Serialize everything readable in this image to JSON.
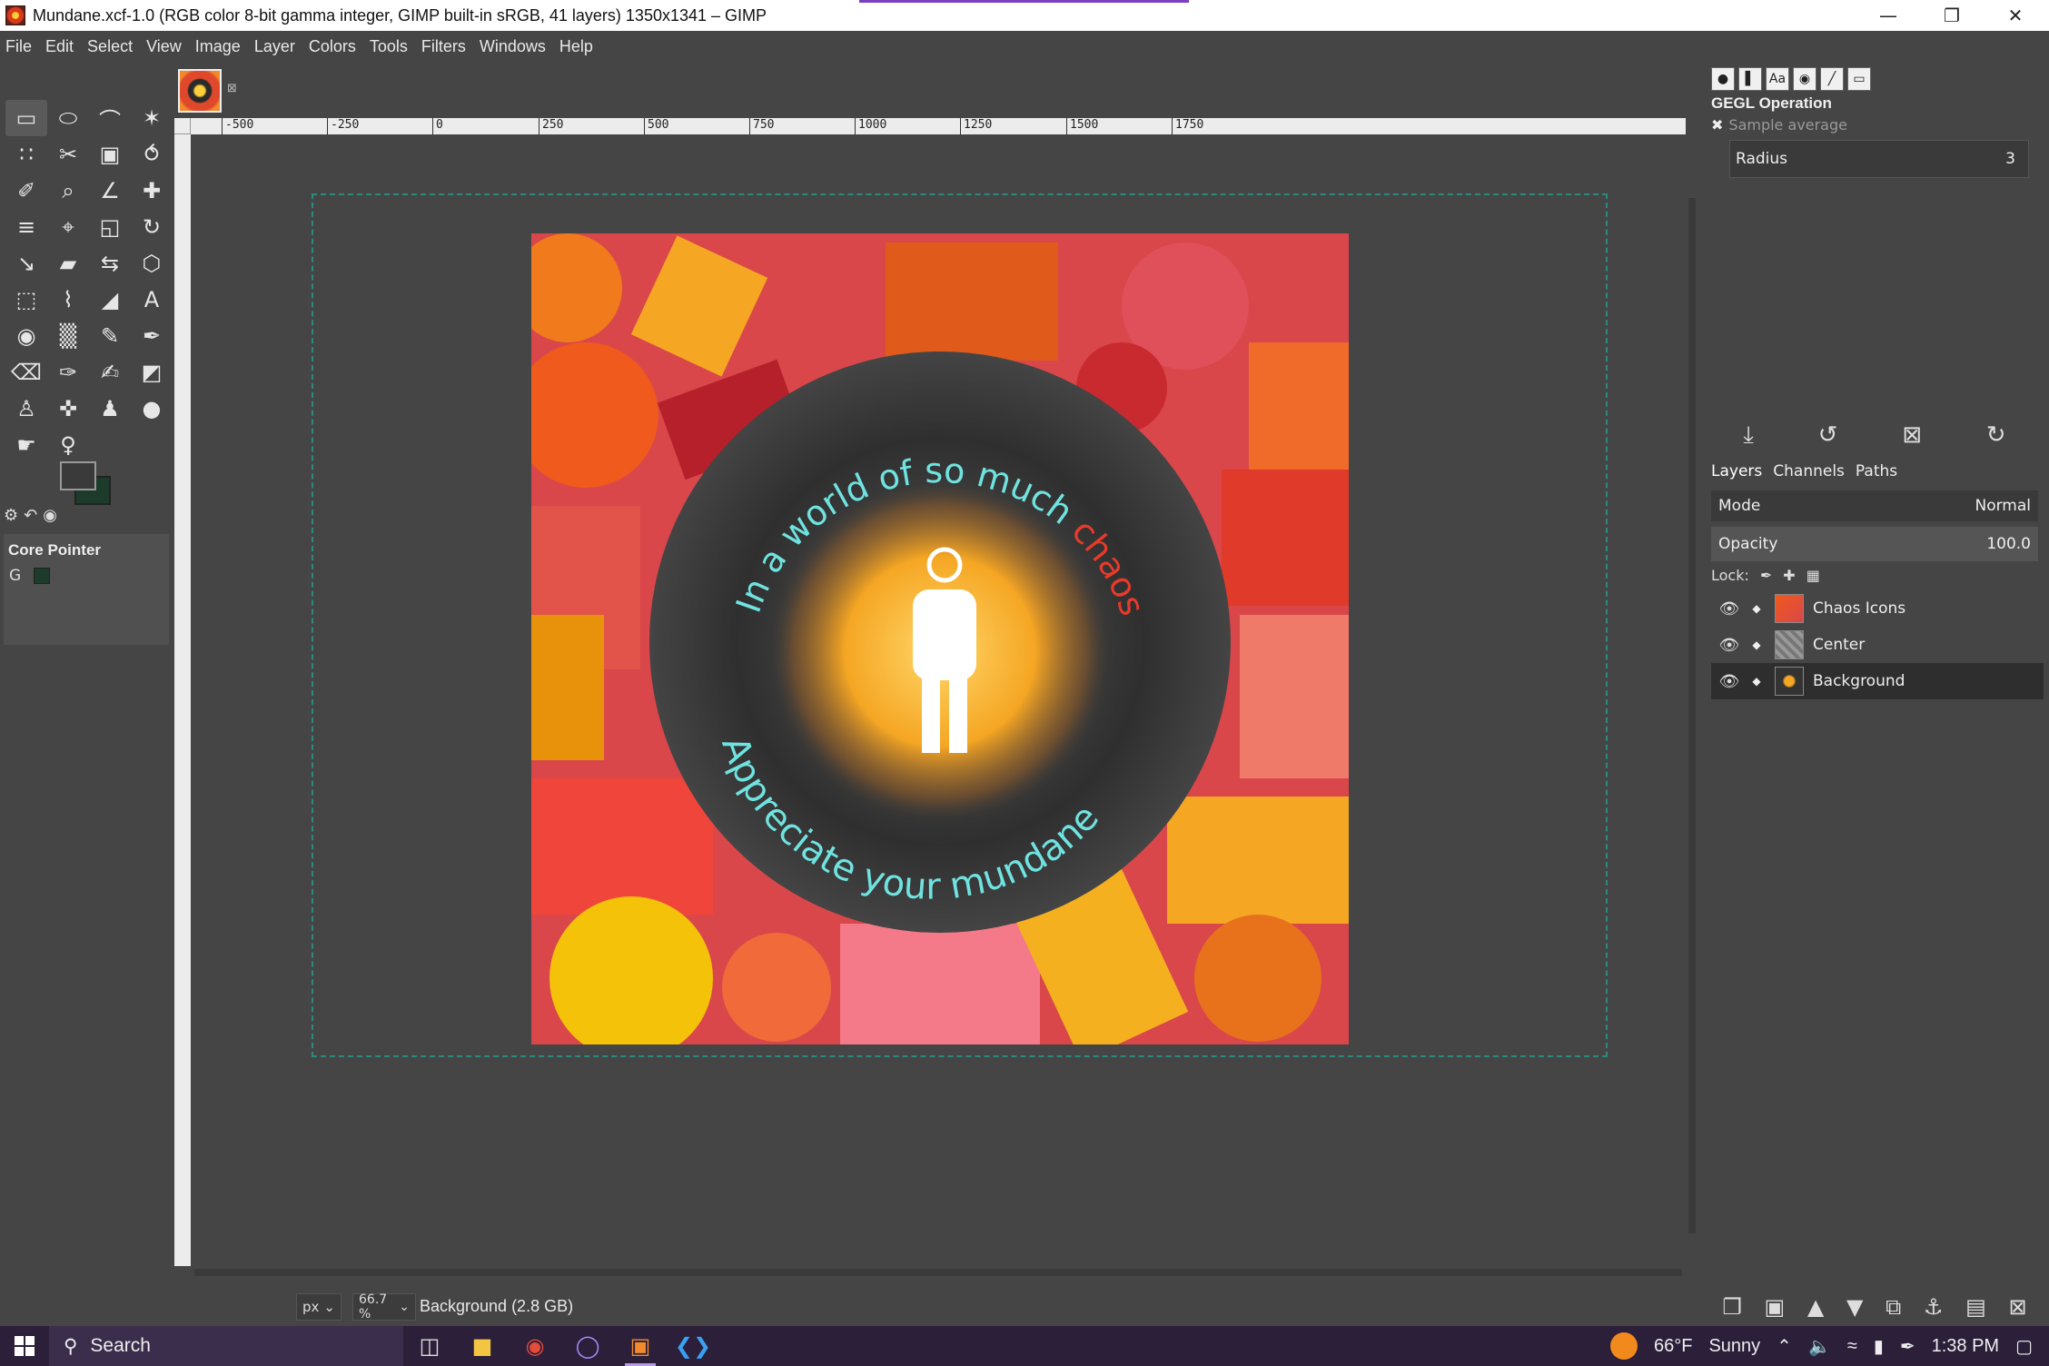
{
  "window": {
    "title": "Mundane.xcf-1.0 (RGB color 8-bit gamma integer, GIMP built-in sRGB, 41 layers) 1350x1341 – GIMP",
    "controls": {
      "minimize": "—",
      "restore": "❐",
      "close": "✕"
    }
  },
  "menu": [
    "File",
    "Edit",
    "Select",
    "View",
    "Image",
    "Layer",
    "Colors",
    "Tools",
    "Filters",
    "Windows",
    "Help"
  ],
  "toolbox": {
    "tools": [
      {
        "name": "rect-select-tool-icon",
        "glyph": "▭"
      },
      {
        "name": "ellipse-select-tool-icon",
        "glyph": "⬭"
      },
      {
        "name": "free-select-tool-icon",
        "glyph": "⌒"
      },
      {
        "name": "fuzzy-select-tool-icon",
        "glyph": "✶"
      },
      {
        "name": "color-select-tool-icon",
        "glyph": "∷"
      },
      {
        "name": "scissors-tool-icon",
        "glyph": "✂"
      },
      {
        "name": "foreground-select-tool-icon",
        "glyph": "▣"
      },
      {
        "name": "paths-tool-icon",
        "glyph": "⥀"
      },
      {
        "name": "color-picker-tool-icon",
        "glyph": "✐"
      },
      {
        "name": "zoom-tool-icon",
        "glyph": "⌕"
      },
      {
        "name": "measure-tool-icon",
        "glyph": "∠"
      },
      {
        "name": "move-tool-icon",
        "glyph": "✚"
      },
      {
        "name": "align-tool-icon",
        "glyph": "≡"
      },
      {
        "name": "crop-tool-icon",
        "glyph": "⌖"
      },
      {
        "name": "unified-transform-tool-icon",
        "glyph": "◱"
      },
      {
        "name": "rotate-tool-icon",
        "glyph": "↻"
      },
      {
        "name": "scale-tool-icon",
        "glyph": "↘"
      },
      {
        "name": "shear-tool-icon",
        "glyph": "▰"
      },
      {
        "name": "flip-tool-icon",
        "glyph": "⇆"
      },
      {
        "name": "perspective-tool-icon",
        "glyph": "⬡"
      },
      {
        "name": "cage-transform-tool-icon",
        "glyph": "⬚"
      },
      {
        "name": "warp-transform-tool-icon",
        "glyph": "⌇"
      },
      {
        "name": "handle-transform-tool-icon",
        "glyph": "◢"
      },
      {
        "name": "text-tool-icon",
        "glyph": "A"
      },
      {
        "name": "bucket-fill-tool-icon",
        "glyph": "◉"
      },
      {
        "name": "gradient-tool-icon",
        "glyph": "▒"
      },
      {
        "name": "pencil-tool-icon",
        "glyph": "✎"
      },
      {
        "name": "paintbrush-tool-icon",
        "glyph": "✒"
      },
      {
        "name": "eraser-tool-icon",
        "glyph": "⌫"
      },
      {
        "name": "airbrush-tool-icon",
        "glyph": "✑"
      },
      {
        "name": "ink-tool-icon",
        "glyph": "✍"
      },
      {
        "name": "mypaint-brush-tool-icon",
        "glyph": "◩"
      },
      {
        "name": "clone-tool-icon",
        "glyph": "♙"
      },
      {
        "name": "heal-tool-icon",
        "glyph": "✜"
      },
      {
        "name": "perspective-clone-tool-icon",
        "glyph": "♟"
      },
      {
        "name": "blur-tool-icon",
        "glyph": "●"
      },
      {
        "name": "smudge-tool-icon",
        "glyph": "☛"
      },
      {
        "name": "dodge-burn-tool-icon",
        "glyph": "♀"
      }
    ],
    "options_tabs": [
      "⚙",
      "↶",
      "◉"
    ],
    "options_title": "Core Pointer",
    "options_icon": "G"
  },
  "canvas": {
    "tab_close": "⊠",
    "ruler_labels": [
      "-500",
      "-250",
      "0",
      "250",
      "500",
      "750",
      "1000",
      "1250",
      "1500",
      "1750"
    ],
    "artwork": {
      "top_text": "In a world of so much",
      "chaos_word": "chaos,",
      "bottom_text": "Appreciate your mundane",
      "colors": {
        "text_cyan": "#6fe3e0",
        "text_red": "#e83a2a",
        "glow": "#f5a623"
      }
    }
  },
  "status": {
    "unit": "px",
    "zoom": "66.7 %",
    "message": "Background (2.8 GB)"
  },
  "dock": {
    "top_tabs": [
      "●",
      "▌",
      "Aa",
      "◉",
      "╱",
      "▭"
    ],
    "gegl_title": "GEGL Operation",
    "gegl_op": "Sample average",
    "radius_label": "Radius",
    "radius_value": "3",
    "gegl_actions": [
      "⤓",
      "↺",
      "⊠",
      "↻"
    ],
    "layer_tabs": [
      "Layers",
      "Channels",
      "Paths"
    ],
    "mode_label": "Mode",
    "mode_value": "Normal",
    "opacity_label": "Opacity",
    "opacity_value": "100.0",
    "lock_label": "Lock:",
    "layers": [
      {
        "name": "Chaos Icons",
        "active": false
      },
      {
        "name": "Center",
        "active": false
      },
      {
        "name": "Background",
        "active": true
      }
    ],
    "layer_actions": [
      "❐",
      "▣",
      "▲",
      "▼",
      "⧉",
      "⚓",
      "▤",
      "⊠"
    ]
  },
  "taskbar": {
    "search_label": "Search",
    "weather_temp": "66°F",
    "weather_cond": "Sunny",
    "time": "1:38 PM"
  }
}
